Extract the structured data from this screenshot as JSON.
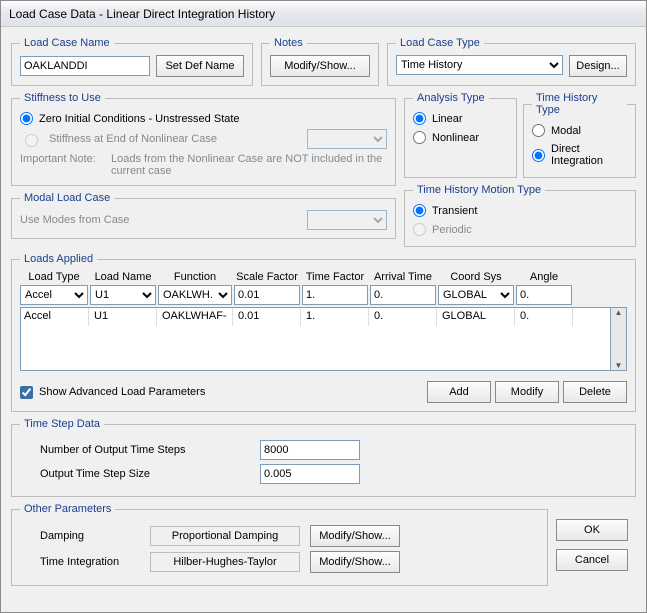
{
  "window": {
    "title": "Load Case Data - Linear Direct Integration History"
  },
  "loadCaseName": {
    "legend": "Load Case Name",
    "value": "OAKLANDDI",
    "setDefBtn": "Set Def Name"
  },
  "notes": {
    "legend": "Notes",
    "modifyBtn": "Modify/Show..."
  },
  "loadCaseType": {
    "legend": "Load Case Type",
    "value": "Time History",
    "designBtn": "Design..."
  },
  "stiffness": {
    "legend": "Stiffness to Use",
    "opt1": "Zero Initial Conditions - Unstressed State",
    "opt2": "Stiffness at End of Nonlinear Case",
    "noteLabel": "Important Note:",
    "noteText": "Loads from the Nonlinear Case are NOT included in the current case"
  },
  "analysisType": {
    "legend": "Analysis Type",
    "linear": "Linear",
    "nonlinear": "Nonlinear"
  },
  "timeHistoryType": {
    "legend": "Time History Type",
    "modal": "Modal",
    "direct": "Direct Integration"
  },
  "motionType": {
    "legend": "Time History Motion Type",
    "transient": "Transient",
    "periodic": "Periodic"
  },
  "modalLoadCase": {
    "legend": "Modal Load Case",
    "label": "Use Modes from Case"
  },
  "loads": {
    "legend": "Loads Applied",
    "headers": {
      "loadType": "Load Type",
      "loadName": "Load Name",
      "function": "Function",
      "scale": "Scale Factor",
      "time": "Time Factor",
      "arrival": "Arrival Time",
      "coord": "Coord Sys",
      "angle": "Angle"
    },
    "input": {
      "loadType": "Accel",
      "loadName": "U1",
      "function": "OAKLWH.",
      "scale": "0.01",
      "time": "1.",
      "arrival": "0.",
      "coord": "GLOBAL",
      "angle": "0."
    },
    "rows": [
      {
        "loadType": "Accel",
        "loadName": "U1",
        "function": "OAKLWHAF-",
        "scale": "0.01",
        "time": "1.",
        "arrival": "0.",
        "coord": "GLOBAL",
        "angle": "0."
      }
    ],
    "showAdvanced": "Show Advanced Load Parameters",
    "addBtn": "Add",
    "modifyBtn": "Modify",
    "deleteBtn": "Delete"
  },
  "timeStep": {
    "legend": "Time Step Data",
    "numStepsLabel": "Number of Output Time Steps",
    "numSteps": "8000",
    "sizeLabel": "Output Time Step Size",
    "size": "0.005"
  },
  "other": {
    "legend": "Other Parameters",
    "dampingLabel": "Damping",
    "dampingValue": "Proportional Damping",
    "dampingBtn": "Modify/Show...",
    "integrationLabel": "Time Integration",
    "integrationValue": "Hilber-Hughes-Taylor",
    "integrationBtn": "Modify/Show..."
  },
  "buttons": {
    "ok": "OK",
    "cancel": "Cancel"
  }
}
